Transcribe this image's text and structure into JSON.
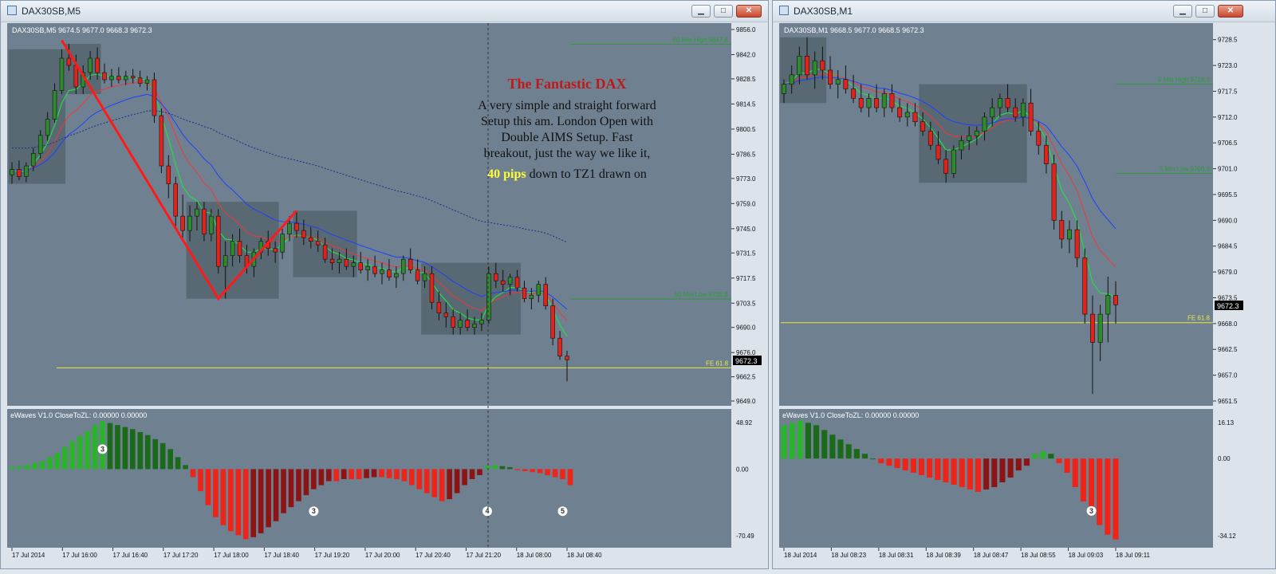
{
  "windows": [
    {
      "title": "DAX30SB,M5",
      "header": "DAX30SB,M5  9674.5 9677.0 9668.3 9672.3",
      "indicator_header": "eWaves V1.0 CloseToZL: 0.00000 0.00000",
      "price_box": "9672.3",
      "osc_ticks": [
        "48.92",
        "0.00",
        "-70.49"
      ],
      "wave_labels": [
        "3",
        "3",
        "4",
        "5"
      ]
    },
    {
      "title": "DAX30SB,M1",
      "header": "DAX30SB,M1  9668.5 9677.0 9668.5 9672.3",
      "indicator_header": "eWaves V1.0 CloseToZL: 0.00000 0.00000",
      "price_box": "9672.3",
      "osc_ticks": [
        "16.13",
        "0.00",
        "-34.12"
      ],
      "wave_labels": [
        "3"
      ]
    }
  ],
  "window_controls": {
    "minimize": "▁",
    "maximize": "□",
    "close": "✕"
  },
  "annotation": {
    "title": "The Fantastic DAX",
    "lines": [
      "A very simple and straight forward",
      "Setup this am. London Open with",
      "Double AIMS Setup. Fast",
      "breakout, just the way we like it,"
    ],
    "highlight": "40 pips",
    "tail": " down to TZ1 drawn on"
  },
  "colors": {
    "chart_bg": "#6f8191",
    "bull": "#2d8a2d",
    "bear": "#e0241b",
    "ema_fast": "#22dd44",
    "ema_mid": "#ff3030",
    "ema_slow": "#1f3fff",
    "ema_long": "#1a2a8a",
    "zone": "#56656f",
    "fe_line": "#e8e840",
    "level_line": "#2e9a3a",
    "osc_green": "#2bb42b",
    "osc_dark_green": "#1a6a1a",
    "osc_red": "#ee2418",
    "osc_dark_red": "#8c1414",
    "annotation_title": "#c01818",
    "annotation_highlight": "#ffff33"
  },
  "chart_data": [
    {
      "type": "candlestick",
      "symbol": "DAX30SB",
      "timeframe": "M5",
      "y_ticks": [
        "9856.0",
        "9842.0",
        "9828.5",
        "9814.5",
        "9800.5",
        "9786.5",
        "9773.0",
        "9759.0",
        "9745.0",
        "9731.5",
        "9717.5",
        "9703.5",
        "9690.0",
        "9676.0",
        "9662.5",
        "9649.0"
      ],
      "ylim": [
        9649.0,
        9856.0
      ],
      "x_ticks": [
        "17 Jul 2014",
        "17 Jul 16:00",
        "17 Jul 16:40",
        "17 Jul 17:20",
        "17 Jul 18:00",
        "17 Jul 18:40",
        "17 Jul 19:20",
        "17 Jul 20:00",
        "17 Jul 20:40",
        "17 Jul 21:20",
        "18 Jul 08:00",
        "18 Jul 08:40"
      ],
      "levels": [
        {
          "label": "60 Min High  9847.8",
          "value": 9847.8
        },
        {
          "label": "60 Min Low  9705.8",
          "value": 9705.8
        },
        {
          "label": "FE 61.8",
          "value": 9667.5
        }
      ],
      "zigzag": [
        {
          "bar": 7,
          "price": 9850
        },
        {
          "bar": 29,
          "price": 9706
        },
        {
          "bar": 40,
          "price": 9755
        }
      ],
      "candles": [
        {
          "o": 9775,
          "h": 9782,
          "l": 9770,
          "c": 9778
        },
        {
          "o": 9778,
          "h": 9783,
          "l": 9772,
          "c": 9774
        },
        {
          "o": 9774,
          "h": 9782,
          "l": 9771,
          "c": 9780
        },
        {
          "o": 9780,
          "h": 9790,
          "l": 9777,
          "c": 9787
        },
        {
          "o": 9787,
          "h": 9800,
          "l": 9784,
          "c": 9797
        },
        {
          "o": 9797,
          "h": 9810,
          "l": 9794,
          "c": 9806
        },
        {
          "o": 9806,
          "h": 9826,
          "l": 9804,
          "c": 9822
        },
        {
          "o": 9822,
          "h": 9845,
          "l": 9820,
          "c": 9840
        },
        {
          "o": 9840,
          "h": 9848,
          "l": 9833,
          "c": 9836
        },
        {
          "o": 9836,
          "h": 9842,
          "l": 9820,
          "c": 9824
        },
        {
          "o": 9824,
          "h": 9836,
          "l": 9820,
          "c": 9832
        },
        {
          "o": 9832,
          "h": 9844,
          "l": 9828,
          "c": 9840
        },
        {
          "o": 9840,
          "h": 9846,
          "l": 9828,
          "c": 9832
        },
        {
          "o": 9832,
          "h": 9837,
          "l": 9826,
          "c": 9828
        },
        {
          "o": 9828,
          "h": 9834,
          "l": 9824,
          "c": 9830
        },
        {
          "o": 9830,
          "h": 9835,
          "l": 9826,
          "c": 9828
        },
        {
          "o": 9828,
          "h": 9833,
          "l": 9825,
          "c": 9830
        },
        {
          "o": 9830,
          "h": 9834,
          "l": 9826,
          "c": 9829
        },
        {
          "o": 9829,
          "h": 9833,
          "l": 9824,
          "c": 9826
        },
        {
          "o": 9826,
          "h": 9830,
          "l": 9822,
          "c": 9828
        },
        {
          "o": 9828,
          "h": 9832,
          "l": 9804,
          "c": 9808
        },
        {
          "o": 9808,
          "h": 9812,
          "l": 9776,
          "c": 9780
        },
        {
          "o": 9780,
          "h": 9786,
          "l": 9762,
          "c": 9770
        },
        {
          "o": 9770,
          "h": 9774,
          "l": 9746,
          "c": 9752
        },
        {
          "o": 9752,
          "h": 9764,
          "l": 9740,
          "c": 9744
        },
        {
          "o": 9744,
          "h": 9758,
          "l": 9738,
          "c": 9752
        },
        {
          "o": 9752,
          "h": 9760,
          "l": 9744,
          "c": 9756
        },
        {
          "o": 9756,
          "h": 9760,
          "l": 9738,
          "c": 9742
        },
        {
          "o": 9742,
          "h": 9756,
          "l": 9738,
          "c": 9752
        },
        {
          "o": 9752,
          "h": 9756,
          "l": 9720,
          "c": 9724
        },
        {
          "o": 9724,
          "h": 9738,
          "l": 9706,
          "c": 9730
        },
        {
          "o": 9730,
          "h": 9742,
          "l": 9724,
          "c": 9738
        },
        {
          "o": 9738,
          "h": 9745,
          "l": 9726,
          "c": 9730
        },
        {
          "o": 9730,
          "h": 9736,
          "l": 9720,
          "c": 9724
        },
        {
          "o": 9724,
          "h": 9734,
          "l": 9718,
          "c": 9732
        },
        {
          "o": 9732,
          "h": 9740,
          "l": 9728,
          "c": 9738
        },
        {
          "o": 9738,
          "h": 9744,
          "l": 9730,
          "c": 9734
        },
        {
          "o": 9734,
          "h": 9738,
          "l": 9726,
          "c": 9732
        },
        {
          "o": 9732,
          "h": 9745,
          "l": 9728,
          "c": 9742
        },
        {
          "o": 9742,
          "h": 9752,
          "l": 9738,
          "c": 9748
        },
        {
          "o": 9748,
          "h": 9755,
          "l": 9740,
          "c": 9744
        },
        {
          "o": 9744,
          "h": 9750,
          "l": 9736,
          "c": 9740
        },
        {
          "o": 9740,
          "h": 9746,
          "l": 9734,
          "c": 9738
        },
        {
          "o": 9738,
          "h": 9744,
          "l": 9732,
          "c": 9736
        },
        {
          "o": 9736,
          "h": 9740,
          "l": 9726,
          "c": 9728
        },
        {
          "o": 9728,
          "h": 9734,
          "l": 9722,
          "c": 9726
        },
        {
          "o": 9726,
          "h": 9732,
          "l": 9720,
          "c": 9728
        },
        {
          "o": 9728,
          "h": 9734,
          "l": 9722,
          "c": 9724
        },
        {
          "o": 9724,
          "h": 9730,
          "l": 9718,
          "c": 9726
        },
        {
          "o": 9726,
          "h": 9732,
          "l": 9720,
          "c": 9722
        },
        {
          "o": 9722,
          "h": 9728,
          "l": 9716,
          "c": 9724
        },
        {
          "o": 9724,
          "h": 9730,
          "l": 9718,
          "c": 9720
        },
        {
          "o": 9720,
          "h": 9726,
          "l": 9714,
          "c": 9722
        },
        {
          "o": 9722,
          "h": 9728,
          "l": 9716,
          "c": 9718
        },
        {
          "o": 9718,
          "h": 9724,
          "l": 9712,
          "c": 9720
        },
        {
          "o": 9720,
          "h": 9730,
          "l": 9716,
          "c": 9728
        },
        {
          "o": 9728,
          "h": 9734,
          "l": 9720,
          "c": 9722
        },
        {
          "o": 9722,
          "h": 9728,
          "l": 9714,
          "c": 9716
        },
        {
          "o": 9716,
          "h": 9724,
          "l": 9712,
          "c": 9720
        },
        {
          "o": 9720,
          "h": 9724,
          "l": 9700,
          "c": 9704
        },
        {
          "o": 9704,
          "h": 9710,
          "l": 9694,
          "c": 9698
        },
        {
          "o": 9698,
          "h": 9704,
          "l": 9690,
          "c": 9696
        },
        {
          "o": 9696,
          "h": 9700,
          "l": 9686,
          "c": 9690
        },
        {
          "o": 9690,
          "h": 9698,
          "l": 9686,
          "c": 9694
        },
        {
          "o": 9694,
          "h": 9700,
          "l": 9688,
          "c": 9690
        },
        {
          "o": 9690,
          "h": 9696,
          "l": 9686,
          "c": 9692
        },
        {
          "o": 9692,
          "h": 9698,
          "l": 9688,
          "c": 9694
        },
        {
          "o": 9694,
          "h": 9724,
          "l": 9692,
          "c": 9720
        },
        {
          "o": 9720,
          "h": 9726,
          "l": 9712,
          "c": 9716
        },
        {
          "o": 9716,
          "h": 9722,
          "l": 9710,
          "c": 9714
        },
        {
          "o": 9714,
          "h": 9720,
          "l": 9708,
          "c": 9718
        },
        {
          "o": 9718,
          "h": 9722,
          "l": 9710,
          "c": 9712
        },
        {
          "o": 9712,
          "h": 9716,
          "l": 9704,
          "c": 9706
        },
        {
          "o": 9706,
          "h": 9712,
          "l": 9700,
          "c": 9708
        },
        {
          "o": 9708,
          "h": 9716,
          "l": 9704,
          "c": 9714
        },
        {
          "o": 9714,
          "h": 9718,
          "l": 9700,
          "c": 9702
        },
        {
          "o": 9702,
          "h": 9706,
          "l": 9680,
          "c": 9684
        },
        {
          "o": 9684,
          "h": 9688,
          "l": 9672,
          "c": 9674
        },
        {
          "o": 9674,
          "h": 9677,
          "l": 9660,
          "c": 9672
        }
      ],
      "oscillator": [
        2,
        3,
        4,
        6,
        8,
        12,
        16,
        22,
        28,
        33,
        38,
        44,
        48,
        46,
        44,
        42,
        40,
        37,
        34,
        30,
        26,
        20,
        12,
        4,
        -8,
        -22,
        -36,
        -48,
        -56,
        -62,
        -66,
        -70,
        -68,
        -64,
        -58,
        -52,
        -44,
        -38,
        -32,
        -26,
        -20,
        -16,
        -12,
        -12,
        -10,
        -10,
        -10,
        -9,
        -8,
        -8,
        -9,
        -10,
        -12,
        -16,
        -20,
        -24,
        -28,
        -32,
        -30,
        -24,
        -16,
        -10,
        -6,
        3,
        4,
        3,
        2,
        -1,
        -2,
        -3,
        -4,
        -6,
        -8,
        -10,
        -16
      ]
    },
    {
      "type": "candlestick",
      "symbol": "DAX30SB",
      "timeframe": "M1",
      "y_ticks": [
        "9728.5",
        "9723.0",
        "9717.5",
        "9712.0",
        "9706.5",
        "9701.0",
        "9695.5",
        "9690.0",
        "9684.5",
        "9679.0",
        "9673.5",
        "9668.0",
        "9662.5",
        "9657.0",
        "9651.5"
      ],
      "ylim": [
        9651.5,
        9731.0
      ],
      "x_ticks": [
        "18 Jul 2014",
        "18 Jul 08:23",
        "18 Jul 08:31",
        "18 Jul 08:39",
        "18 Jul 08:47",
        "18 Jul 08:55",
        "18 Jul 09:03",
        "18 Jul 09:11"
      ],
      "levels": [
        {
          "label": "5 Min High  9719.0",
          "value": 9719.0
        },
        {
          "label": "5 Min Low  9700.0",
          "value": 9700.0
        },
        {
          "label": "FE 61.8",
          "value": 9668.2
        }
      ],
      "candles": [
        {
          "o": 9717,
          "h": 9720,
          "l": 9715,
          "c": 9719
        },
        {
          "o": 9719,
          "h": 9723,
          "l": 9717,
          "c": 9721
        },
        {
          "o": 9721,
          "h": 9727,
          "l": 9719,
          "c": 9725
        },
        {
          "o": 9725,
          "h": 9729,
          "l": 9720,
          "c": 9721
        },
        {
          "o": 9721,
          "h": 9726,
          "l": 9718,
          "c": 9724
        },
        {
          "o": 9724,
          "h": 9727,
          "l": 9720,
          "c": 9722
        },
        {
          "o": 9722,
          "h": 9725,
          "l": 9718,
          "c": 9719
        },
        {
          "o": 9719,
          "h": 9722,
          "l": 9716,
          "c": 9720
        },
        {
          "o": 9720,
          "h": 9723,
          "l": 9717,
          "c": 9718
        },
        {
          "o": 9718,
          "h": 9721,
          "l": 9715,
          "c": 9716
        },
        {
          "o": 9716,
          "h": 9719,
          "l": 9713,
          "c": 9714
        },
        {
          "o": 9714,
          "h": 9717,
          "l": 9712,
          "c": 9716
        },
        {
          "o": 9716,
          "h": 9719,
          "l": 9713,
          "c": 9714
        },
        {
          "o": 9714,
          "h": 9718,
          "l": 9712,
          "c": 9717
        },
        {
          "o": 9717,
          "h": 9719,
          "l": 9713,
          "c": 9714
        },
        {
          "o": 9714,
          "h": 9716,
          "l": 9711,
          "c": 9712
        },
        {
          "o": 9712,
          "h": 9715,
          "l": 9710,
          "c": 9713
        },
        {
          "o": 9713,
          "h": 9715,
          "l": 9710,
          "c": 9711
        },
        {
          "o": 9711,
          "h": 9713,
          "l": 9708,
          "c": 9709
        },
        {
          "o": 9709,
          "h": 9711,
          "l": 9705,
          "c": 9706
        },
        {
          "o": 9706,
          "h": 9709,
          "l": 9702,
          "c": 9703
        },
        {
          "o": 9703,
          "h": 9705,
          "l": 9698,
          "c": 9700
        },
        {
          "o": 9700,
          "h": 9706,
          "l": 9699,
          "c": 9705
        },
        {
          "o": 9705,
          "h": 9708,
          "l": 9703,
          "c": 9707
        },
        {
          "o": 9707,
          "h": 9710,
          "l": 9705,
          "c": 9708
        },
        {
          "o": 9708,
          "h": 9710,
          "l": 9706,
          "c": 9709
        },
        {
          "o": 9709,
          "h": 9713,
          "l": 9707,
          "c": 9712
        },
        {
          "o": 9712,
          "h": 9716,
          "l": 9710,
          "c": 9714
        },
        {
          "o": 9714,
          "h": 9717,
          "l": 9712,
          "c": 9716
        },
        {
          "o": 9716,
          "h": 9719,
          "l": 9713,
          "c": 9714
        },
        {
          "o": 9714,
          "h": 9716,
          "l": 9711,
          "c": 9712
        },
        {
          "o": 9712,
          "h": 9716,
          "l": 9710,
          "c": 9715
        },
        {
          "o": 9715,
          "h": 9718,
          "l": 9708,
          "c": 9709
        },
        {
          "o": 9709,
          "h": 9711,
          "l": 9704,
          "c": 9706
        },
        {
          "o": 9706,
          "h": 9708,
          "l": 9700,
          "c": 9702
        },
        {
          "o": 9702,
          "h": 9704,
          "l": 9688,
          "c": 9690
        },
        {
          "o": 9690,
          "h": 9692,
          "l": 9684,
          "c": 9686
        },
        {
          "o": 9686,
          "h": 9690,
          "l": 9683,
          "c": 9688
        },
        {
          "o": 9688,
          "h": 9690,
          "l": 9680,
          "c": 9682
        },
        {
          "o": 9682,
          "h": 9684,
          "l": 9668,
          "c": 9670
        },
        {
          "o": 9670,
          "h": 9674,
          "l": 9653,
          "c": 9664
        },
        {
          "o": 9664,
          "h": 9672,
          "l": 9660,
          "c": 9670
        },
        {
          "o": 9670,
          "h": 9678,
          "l": 9664,
          "c": 9674
        },
        {
          "o": 9674,
          "h": 9677,
          "l": 9668,
          "c": 9672
        }
      ],
      "oscillator": [
        14,
        15,
        16,
        15,
        14,
        12,
        10,
        8,
        6,
        4,
        2,
        0,
        -2,
        -3,
        -4,
        -5,
        -6,
        -7,
        -8,
        -9,
        -10,
        -11,
        -12,
        -13,
        -14,
        -13,
        -12,
        -10,
        -8,
        -5,
        -3,
        2,
        3,
        2,
        -2,
        -6,
        -12,
        -18,
        -24,
        -28,
        -32,
        -34
      ]
    }
  ]
}
